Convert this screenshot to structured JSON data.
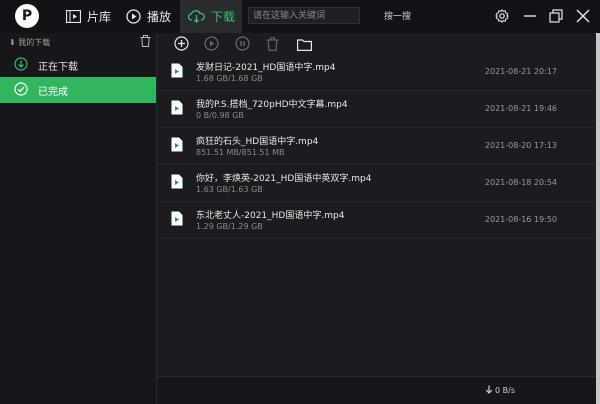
{
  "app": {
    "logo_letter": "P"
  },
  "nav": {
    "library": {
      "label": "片库",
      "icon": "film-library-icon"
    },
    "play": {
      "label": "播放",
      "icon": "play-circle-icon"
    },
    "download": {
      "label": "下载",
      "icon": "cloud-download-icon",
      "active": true
    }
  },
  "search": {
    "placeholder": "请在这输入关键词",
    "button_label": "搜一搜"
  },
  "window_controls": [
    "settings-gear-icon",
    "minimize-icon",
    "restore-icon",
    "close-icon"
  ],
  "sidebar": {
    "header": "我的下载",
    "items": [
      {
        "label": "正在下载",
        "icon": "download-circle-icon",
        "active": false
      },
      {
        "label": "已完成",
        "icon": "check-circle-icon",
        "active": true
      }
    ]
  },
  "toolbar": {
    "icons": [
      "add-icon",
      "play-icon",
      "pause-icon",
      "delete-icon",
      "folder-icon"
    ]
  },
  "files": [
    {
      "name": "发财日记-2021_HD国语中字.mp4",
      "size": "1.68 GB/1.68 GB",
      "date": "2021-08-21 20:17"
    },
    {
      "name": "我的P.S.搭档_720pHD中文字幕.mp4",
      "size": "0 B/0.98 GB",
      "date": "2021-08-21 19:46"
    },
    {
      "name": "疯狂的石头_HD国语中字.mp4",
      "size": "851.51 MB/851.51 MB",
      "date": "2021-08-20 17:13"
    },
    {
      "name": "你好，李焕英-2021_HD国语中英双字.mp4",
      "size": "1.63 GB/1.63 GB",
      "date": "2021-08-18 20:54"
    },
    {
      "name": "东北老丈人-2021_HD国语中字.mp4",
      "size": "1.29 GB/1.29 GB",
      "date": "2021-08-16 19:50"
    }
  ],
  "status": {
    "speed": "0 B/s"
  },
  "colors": {
    "accent": "#31b65d",
    "titlebar": "#121316",
    "background": "#1b1c20"
  }
}
